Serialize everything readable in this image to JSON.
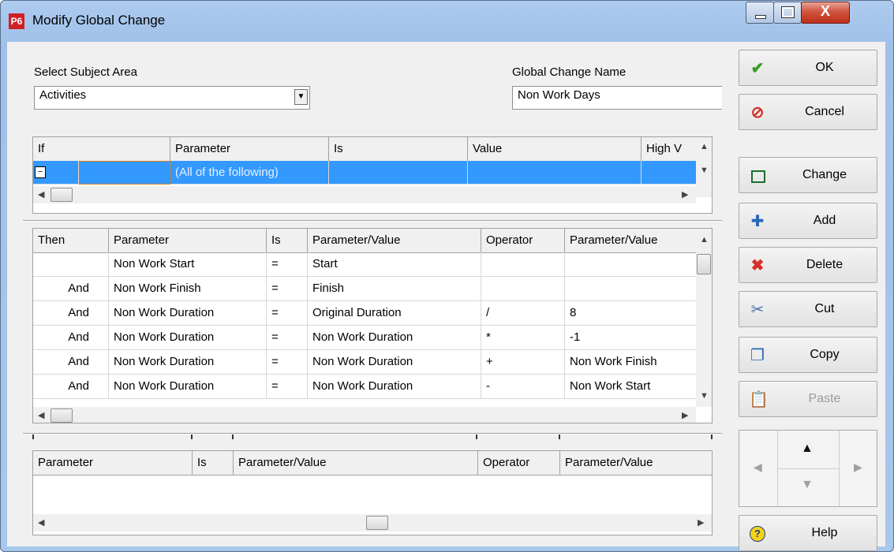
{
  "window": {
    "app_icon": "P6",
    "title": "Modify Global Change"
  },
  "subject": {
    "label": "Select Subject Area",
    "value": "Activities"
  },
  "gcname": {
    "label": "Global Change Name",
    "value": "Non Work Days"
  },
  "if_grid": {
    "columns": [
      "If",
      "Parameter",
      "Is",
      "Value",
      "High V"
    ],
    "rows": [
      {
        "toggle": "−",
        "if": "",
        "parameter": "(All of the following)",
        "is": "",
        "value": "",
        "high": ""
      }
    ]
  },
  "then_grid": {
    "columns": [
      "Then",
      "Parameter",
      "Is",
      "Parameter/Value",
      "Operator",
      "Parameter/Value"
    ],
    "rows": [
      [
        "",
        "Non Work Start",
        "=",
        "Start",
        "",
        ""
      ],
      [
        "And",
        "Non Work Finish",
        "=",
        "Finish",
        "",
        ""
      ],
      [
        "And",
        "Non Work Duration",
        "=",
        "Original Duration",
        "/",
        "8"
      ],
      [
        "And",
        "Non Work Duration",
        "=",
        "Non Work Duration",
        "*",
        "-1"
      ],
      [
        "And",
        "Non Work Duration",
        "=",
        "Non Work Duration",
        "+",
        "Non Work Finish"
      ],
      [
        "And",
        "Non Work Duration",
        "=",
        "Non Work Duration",
        "-",
        "Non Work Start"
      ]
    ]
  },
  "else_grid": {
    "columns": [
      "Parameter",
      "Is",
      "Parameter/Value",
      "Operator",
      "Parameter/Value"
    ]
  },
  "buttons": {
    "ok": "OK",
    "cancel": "Cancel",
    "change": "Change",
    "add": "Add",
    "delete": "Delete",
    "cut": "Cut",
    "copy": "Copy",
    "paste": "Paste",
    "help": "Help"
  },
  "icons": {
    "ok": "checkmark-icon",
    "cancel": "no-entry-icon",
    "change": "change-icon",
    "add": "plus-icon",
    "delete": "red-x-icon",
    "cut": "scissors-icon",
    "copy": "copy-icon",
    "paste": "clipboard-icon",
    "help": "help-icon"
  },
  "colors": {
    "selection": "#3399ff",
    "title_bg": "#a8c7ec",
    "close": "#c7402a"
  }
}
